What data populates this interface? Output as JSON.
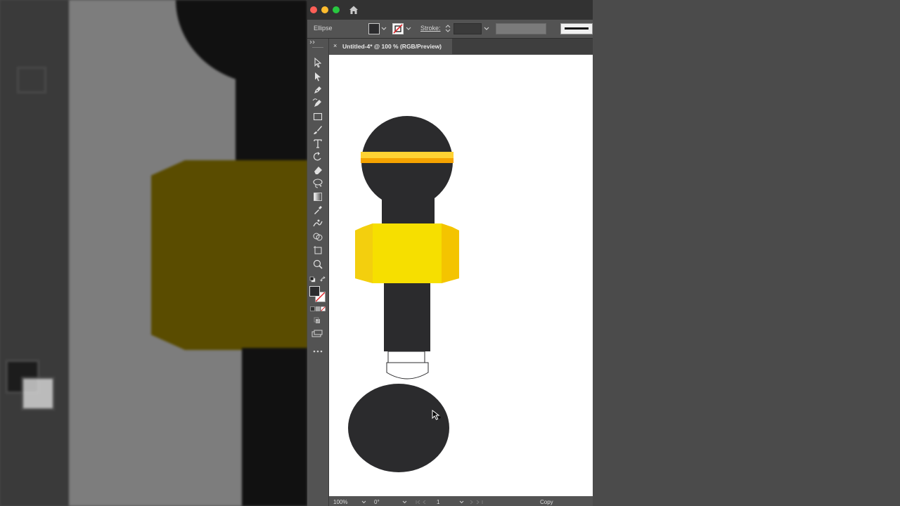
{
  "window": {
    "tab_close": "×",
    "tab_title": "Untitled-4* @ 100 % (RGB/Preview)"
  },
  "control_bar": {
    "object_type": "Ellipse",
    "stroke_label": "Stroke:",
    "fill_color": "#2b2b2d",
    "stroke": "none"
  },
  "tools": [
    "selection-tool-icon",
    "direct-selection-tool-icon",
    "pen-tool-icon",
    "curvature-tool-icon",
    "rectangle-tool-icon",
    "paintbrush-tool-icon",
    "type-tool-icon",
    "rotate-tool-icon",
    "eraser-tool-icon",
    "lasso-tool-icon",
    "gradient-tool-icon",
    "eyedropper-tool-icon",
    "puppet-warp-tool-icon",
    "shape-builder-tool-icon",
    "artboard-tool-icon",
    "zoom-tool-icon",
    "default-colors-icon",
    "swap-colors-icon",
    "fill-stroke-icon",
    "color-modes-icon",
    "draw-modes-icon",
    "screen-mode-icon",
    "more-tools-icon"
  ],
  "status_bar": {
    "zoom": "100%",
    "rotation": "0°",
    "artboard_number": "1",
    "toggle_label": "Copy"
  },
  "colors": {
    "mic_dark": "#2b2b2d",
    "band_yellow": "#f6df00",
    "band_shade": "#f4c400",
    "stripe_orange": "#f5a300",
    "stripe_yellow": "#ffd233"
  }
}
